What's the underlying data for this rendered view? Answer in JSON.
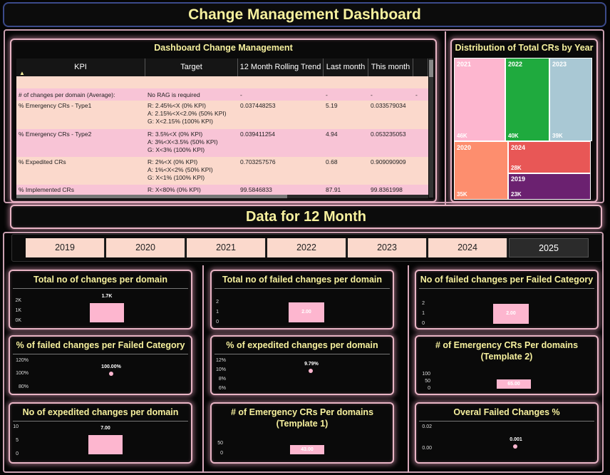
{
  "header": {
    "title": "Change Management Dashboard"
  },
  "kpi_panel": {
    "title": "Dashboard Change Management",
    "columns": [
      "KPI",
      "Target",
      "12 Month Rolling Trend",
      "Last month",
      "This month"
    ],
    "rows": [
      {
        "kpi": "# of changes per domain (Average):",
        "target": "No RAG is required",
        "trend": "-",
        "last": "-",
        "this": "-",
        "extra": "-"
      },
      {
        "kpi": "% Emergency CRs - Type1",
        "target": "R: 2.45%<X (0% KPI)\nA: 2.15%<X<2.0% (50% KPI)\nG: X<2.15% (100% KPI)",
        "trend": "0.037448253",
        "last": "5.19",
        "this": "0.033579034",
        "extra": ""
      },
      {
        "kpi": "% Emergency CRs - Type2",
        "target": "R: 3.5%<X (0% KPI)\nA: 3%<X<3.5% (50% KPI)\nG: X<3% (100% KPI)",
        "trend": "0.039411254",
        "last": "4.94",
        "this": "0.053235053",
        "extra": ""
      },
      {
        "kpi": "% Expedited CRs",
        "target": "R: 2%<X (0% KPI)\nA: 1%<X<2% (50% KPI)\nG: X<1% (100% KPI)",
        "trend": "0.703257576",
        "last": "0.68",
        "this": "0.909090909",
        "extra": ""
      },
      {
        "kpi": "% Implemented CRs",
        "target": "R: X<80% (0% KPI)",
        "trend": "99.5846833",
        "last": "87.91",
        "this": "99.8361998",
        "extra": ""
      }
    ]
  },
  "treemap": {
    "title": "Distribution of Total CRs by Year",
    "items": [
      {
        "year": "2021",
        "value": "46K",
        "color": "#fdb6cf"
      },
      {
        "year": "2022",
        "value": "40K",
        "color": "#1faa3e"
      },
      {
        "year": "2023",
        "value": "39K",
        "color": "#a9c8d4"
      },
      {
        "year": "2020",
        "value": "35K",
        "color": "#fd8e6e"
      },
      {
        "year": "2024",
        "value": "28K",
        "color": "#e85756"
      },
      {
        "year": "2019",
        "value": "23K",
        "color": "#6b2170"
      }
    ]
  },
  "section": {
    "title": "Data for 12 Month"
  },
  "years": [
    "2019",
    "2020",
    "2021",
    "2022",
    "2023",
    "2024",
    "2025"
  ],
  "selected_year": "2025",
  "cards": {
    "c1": {
      "title": "Total no of changes per domain",
      "ticks": [
        "2K",
        "1K",
        "0K"
      ],
      "label": "1.7K"
    },
    "c2": {
      "title": "Total no of failed changes per domain",
      "ticks": [
        "2",
        "1",
        "0"
      ],
      "label": "2.00"
    },
    "c3": {
      "title": "No of failed changes per Failed Category",
      "ticks": [
        "2",
        "1",
        "0"
      ],
      "label": "2.00"
    },
    "c4": {
      "title": "% of failed changes per Failed Category",
      "ticks": [
        "120%",
        "100%",
        "80%"
      ],
      "label": "100.00%"
    },
    "c5": {
      "title": "% of expedited changes per domain",
      "ticks": [
        "12%",
        "10%",
        "8%",
        "6%"
      ],
      "label": "9.79%"
    },
    "c6": {
      "title": "# of Emergency CRs Per domains (Template 2)",
      "ticks": [
        "100",
        "50",
        "0"
      ],
      "label": "65.00"
    },
    "c7": {
      "title": "No of expedited changes per domain",
      "ticks": [
        "10",
        "5",
        "0"
      ],
      "label": "7.00"
    },
    "c8": {
      "title": "# of Emergency CRs Per domains (Template 1)",
      "ticks": [
        "50",
        "0"
      ],
      "label": "43.00"
    },
    "c9": {
      "title": "Overal Failed Changes %",
      "ticks": [
        "0.02",
        "0.00"
      ],
      "label": "0.001"
    }
  },
  "colors": {
    "accent": "#f7f19e",
    "bar": "#fdb6cf",
    "border": "#e8b4c4"
  }
}
